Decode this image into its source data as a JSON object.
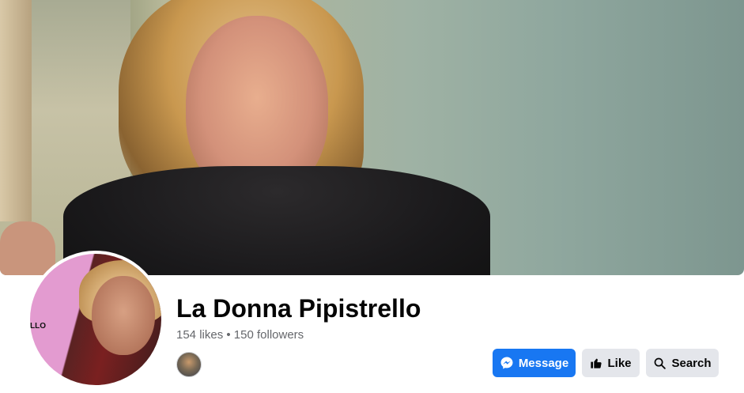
{
  "page": {
    "name": "La Donna Pipistrello",
    "stats": "154 likes • 150 followers",
    "avatar_text": "LLO"
  },
  "actions": {
    "message_label": "Message",
    "like_label": "Like",
    "search_label": "Search"
  },
  "icons": {
    "message": "messenger-icon",
    "like": "thumbs-up-icon",
    "search": "search-icon"
  },
  "colors": {
    "primary": "#1877f2",
    "secondary_button": "#e4e6eb",
    "name_text": "#050505",
    "meta_text": "#65676b"
  }
}
